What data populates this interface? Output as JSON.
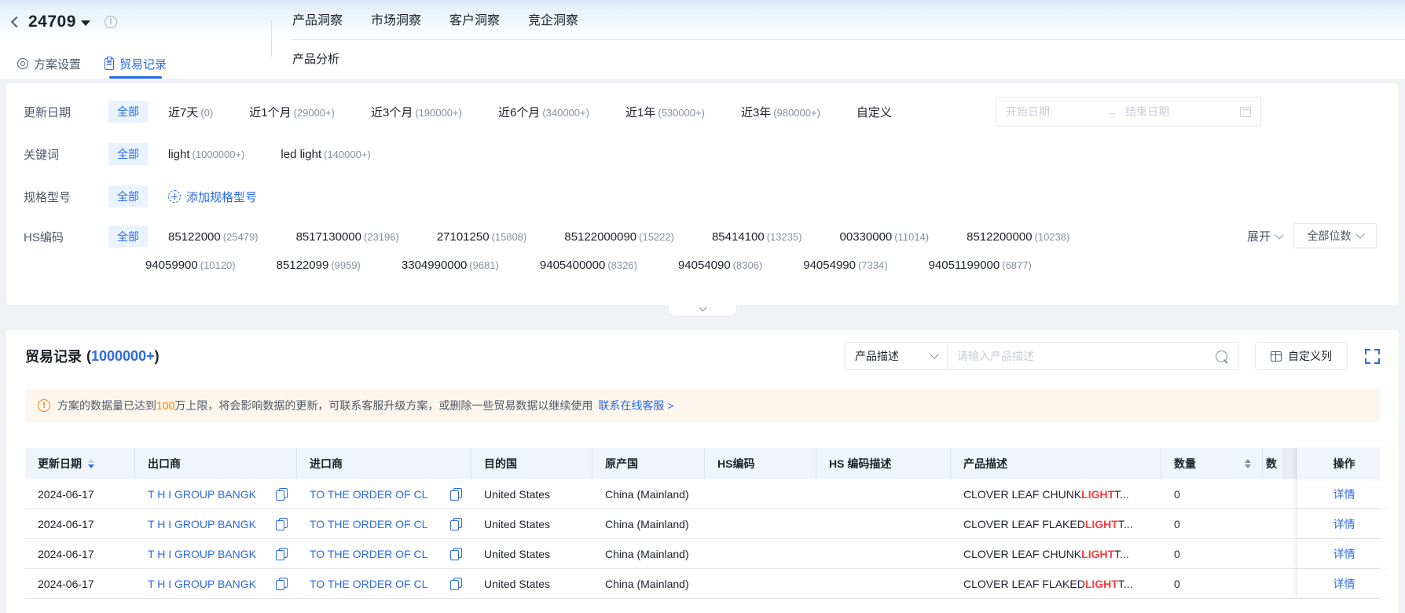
{
  "colors": {
    "accent": "#2A6AE9",
    "keyword_red": "#F53F3F",
    "warn_orange": "#FF7D00"
  },
  "topbar": {
    "plan_id": "24709",
    "nav": [
      "产品洞察",
      "市场洞察",
      "客户洞察",
      "竞企洞察"
    ],
    "sub_nav": "产品分析",
    "tabs": [
      {
        "label": "方案设置"
      },
      {
        "label": "贸易记录"
      }
    ]
  },
  "filters": {
    "date": {
      "label": "更新日期",
      "all": "全部",
      "options": [
        {
          "name": "近7天",
          "count": "(0)"
        },
        {
          "name": "近1个月",
          "count": "(29000+)"
        },
        {
          "name": "近3个月",
          "count": "(190000+)"
        },
        {
          "name": "近6个月",
          "count": "(340000+)"
        },
        {
          "name": "近1年",
          "count": "(530000+)"
        },
        {
          "name": "近3年",
          "count": "(980000+)"
        }
      ],
      "custom": "自定义",
      "start_placeholder": "开始日期",
      "end_placeholder": "结束日期",
      "range_arrow": "→"
    },
    "keyword": {
      "label": "关键词",
      "all": "全部",
      "options": [
        {
          "name": "light",
          "count": "(1000000+)"
        },
        {
          "name": "led light",
          "count": "(140000+)"
        }
      ]
    },
    "spec": {
      "label": "规格型号",
      "all": "全部",
      "add": "添加规格型号"
    },
    "hs": {
      "label": "HS编码",
      "all": "全部",
      "line1": [
        {
          "name": "85122000",
          "count": "(25479)"
        },
        {
          "name": "8517130000",
          "count": "(23196)"
        },
        {
          "name": "27101250",
          "count": "(15808)"
        },
        {
          "name": "85122000090",
          "count": "(15222)"
        },
        {
          "name": "85414100",
          "count": "(13235)"
        },
        {
          "name": "00330000",
          "count": "(11014)"
        },
        {
          "name": "8512200000",
          "count": "(10238)"
        }
      ],
      "line2": [
        {
          "name": "94059900",
          "count": "(10120)"
        },
        {
          "name": "85122099",
          "count": "(9959)"
        },
        {
          "name": "3304990000",
          "count": "(9681)"
        },
        {
          "name": "9405400000",
          "count": "(8326)"
        },
        {
          "name": "94054090",
          "count": "(8306)"
        },
        {
          "name": "94054990",
          "count": "(7334)"
        },
        {
          "name": "94051199000",
          "count": "(6877)"
        }
      ],
      "expand": "展开",
      "digits": "全部位数"
    }
  },
  "records": {
    "title": "贸易记录",
    "count_open": "(",
    "count": "1000000+",
    "count_close": ")",
    "search_type": "产品描述",
    "search_placeholder": "请输入产品描述",
    "customize": "自定义列",
    "banner": {
      "icon": "!",
      "pre": "方案的数据量已达到",
      "highlight": "100",
      "mid": "万上限，将会影响数据的更新，可联系客服升级方案，或删除一些贸易数据以继续使用",
      "link": "联系在线客服 >"
    },
    "columns": {
      "date": "更新日期",
      "exporter": "出口商",
      "importer": "进口商",
      "dest": "目的国",
      "origin": "原产国",
      "hs": "HS编码",
      "hs_desc": "HS 编码描述",
      "desc": "产品描述",
      "qty": "数量",
      "qty2": "数",
      "action": "操作"
    },
    "rows": [
      {
        "date": "2024-06-17",
        "exporter": "T H I GROUP BANGK",
        "importer": "TO THE ORDER OF CL",
        "dest": "United States",
        "origin": "China (Mainland)",
        "hs": "",
        "hs_desc": "",
        "desc_pre": "CLOVER LEAF CHUNK ",
        "desc_hl": "LIGHT",
        "desc_post": " T...",
        "qty": "0",
        "action": "详情"
      },
      {
        "date": "2024-06-17",
        "exporter": "T H I GROUP BANGK",
        "importer": "TO THE ORDER OF CL",
        "dest": "United States",
        "origin": "China (Mainland)",
        "hs": "",
        "hs_desc": "",
        "desc_pre": "CLOVER LEAF FLAKED ",
        "desc_hl": "LIGHT",
        "desc_post": " T...",
        "qty": "0",
        "action": "详情"
      },
      {
        "date": "2024-06-17",
        "exporter": "T H I GROUP BANGK",
        "importer": "TO THE ORDER OF CL",
        "dest": "United States",
        "origin": "China (Mainland)",
        "hs": "",
        "hs_desc": "",
        "desc_pre": "CLOVER LEAF CHUNK ",
        "desc_hl": "LIGHT",
        "desc_post": " T...",
        "qty": "0",
        "action": "详情"
      },
      {
        "date": "2024-06-17",
        "exporter": "T H I GROUP BANGK",
        "importer": "TO THE ORDER OF CL",
        "dest": "United States",
        "origin": "China (Mainland)",
        "hs": "",
        "hs_desc": "",
        "desc_pre": "CLOVER LEAF FLAKED ",
        "desc_hl": "LIGHT",
        "desc_post": " T...",
        "qty": "0",
        "action": "详情"
      }
    ]
  }
}
